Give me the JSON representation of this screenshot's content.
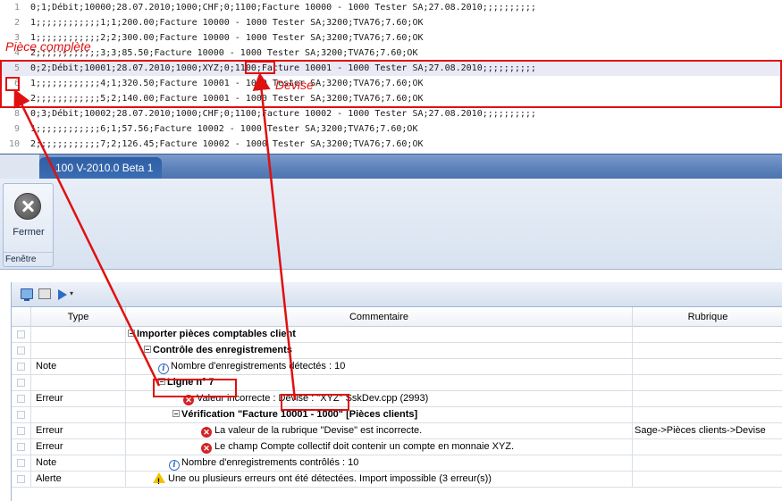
{
  "editor": {
    "lines": [
      {
        "num": "1",
        "text": "0;1;Débit;10000;28.07.2010;1000;CHF;0;1100;Facture 10000 - 1000 Tester SA;27.08.2010;;;;;;;;;;"
      },
      {
        "num": "2",
        "text": "1;;;;;;;;;;;;1;1;200.00;Facture 10000 - 1000 Tester SA;3200;TVA76;7.60;OK"
      },
      {
        "num": "3",
        "text": "1;;;;;;;;;;;;2;2;300.00;Facture 10000 - 1000 Tester SA;3200;TVA76;7.60;OK"
      },
      {
        "num": "4",
        "text": "2;;;;;;;;;;;;3;3;85.50;Facture 10000 - 1000 Tester SA;3200;TVA76;7.60;OK"
      },
      {
        "num": "5",
        "text": "0;2;Débit;10001;28.07.2010;1000;XYZ;0;1100;Facture 10001 - 1000 Tester SA;27.08.2010;;;;;;;;;;"
      },
      {
        "num": "6",
        "text": "1;;;;;;;;;;;;4;1;320.50;Facture 10001 - 1000 Tester SA;3200;TVA76;7.60;OK"
      },
      {
        "num": "7",
        "text": "2;;;;;;;;;;;;5;2;140.00;Facture 10001 - 1000 Tester SA;3200;TVA76;7.60;OK"
      },
      {
        "num": "8",
        "text": "0;3;Débit;10002;28.07.2010;1000;CHF;0;1100;Facture 10002 - 1000 Tester SA;27.08.2010;;;;;;;;;;"
      },
      {
        "num": "9",
        "text": "1;;;;;;;;;;;;6;1;57.56;Facture 10002 - 1000 Tester SA;3200;TVA76;7.60;OK"
      },
      {
        "num": "10",
        "text": "2;;;;;;;;;;;;7;2;126.45;Facture 10002 - 1000 Tester SA;3200;TVA76;7.60;OK"
      }
    ]
  },
  "window": {
    "title": "100 V-2010.0 Beta 1"
  },
  "ribbon": {
    "close_label": "Fermer",
    "group_label": "Fenêtre"
  },
  "grid": {
    "columns": {
      "type": "Type",
      "comment": "Commentaire",
      "field": "Rubrique"
    },
    "rows": [
      {
        "type": "",
        "comment": "Importer pièces comptables client",
        "field": "",
        "icon": "expand-icon",
        "bold": true
      },
      {
        "type": "",
        "comment": "Contrôle des enregistrements",
        "field": "",
        "icon": "expand-icon",
        "bold": true
      },
      {
        "type": "Note",
        "comment": "Nombre d'enregistrements détectés : 10",
        "field": "",
        "icon": "info-icon",
        "bold": false
      },
      {
        "type": "",
        "comment": "Ligne n° 7",
        "field": "",
        "icon": "expand-icon",
        "bold": true
      },
      {
        "type": "Erreur",
        "comment_prefix": "Valeur incorrecte : ",
        "comment_highlight": "Devise : \"XYZ\"",
        "comment_suffix": " SskDev.cpp (2993)",
        "field": "",
        "icon": "error-icon",
        "bold": false
      },
      {
        "type": "",
        "comment": "Vérification \"Facture 10001 - 1000\" [Pièces clients]",
        "field": "",
        "icon": "expand-icon",
        "bold": true
      },
      {
        "type": "Erreur",
        "comment": "La valeur de la rubrique \"Devise\" est incorrecte.",
        "field": "Sage->Pièces clients->Devise",
        "icon": "error-icon",
        "bold": false
      },
      {
        "type": "Erreur",
        "comment": "Le champ Compte collectif doit contenir un compte en monnaie XYZ.",
        "field": "",
        "icon": "error-icon",
        "bold": false
      },
      {
        "type": "Note",
        "comment": "Nombre d'enregistrements contrôlés : 10",
        "field": "",
        "icon": "info-icon",
        "bold": false
      },
      {
        "type": "Alerte",
        "comment": "Une ou plusieurs erreurs ont été détectées. Import impossible (3 erreur(s))",
        "field": "",
        "icon": "warning-icon",
        "bold": false
      }
    ]
  },
  "annotations": {
    "piece_label": "Pièce complète",
    "devise_label": "Devise",
    "color": "#e01010"
  }
}
